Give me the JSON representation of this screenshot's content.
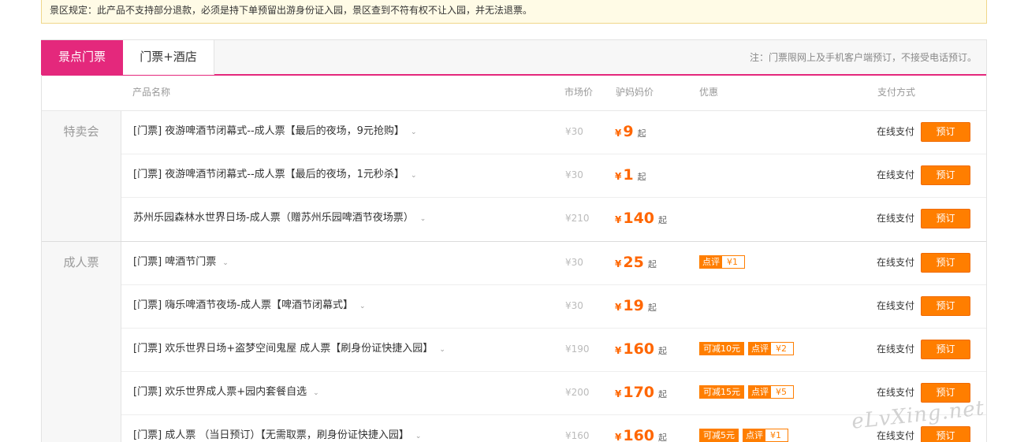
{
  "notice": "景区规定：此产品不支持部分退款，必须是持下单预留出游身份证入园，景区查到不符有权不让入园，并无法退票。",
  "tabs": {
    "active": "景点门票",
    "other": "门票+酒店",
    "note": "注：门票限网上及手机客户端预订，不接受电话预订。"
  },
  "columns": {
    "name": "产品名称",
    "market": "市场价",
    "price": "驴妈妈价",
    "promo": "优惠",
    "pay": "支付方式"
  },
  "groups": [
    {
      "label": "特卖会",
      "rows": [
        {
          "name": "[门票] 夜游啤酒节闭幕式--成人票【最后的夜场，9元抢购】",
          "market": "¥30",
          "currency": "¥",
          "price": "9",
          "qi": "起",
          "pay": "在线支付",
          "book": "预订"
        },
        {
          "name": "[门票] 夜游啤酒节闭幕式--成人票【最后的夜场，1元秒杀】",
          "market": "¥30",
          "currency": "¥",
          "price": "1",
          "qi": "起",
          "pay": "在线支付",
          "book": "预订"
        },
        {
          "name": "苏州乐园森林水世界日场-成人票（赠苏州乐园啤酒节夜场票）",
          "market": "¥210",
          "currency": "¥",
          "price": "140",
          "qi": "起",
          "pay": "在线支付",
          "book": "预订"
        }
      ]
    },
    {
      "label": "成人票",
      "rows": [
        {
          "name": "[门票] 啤酒节门票",
          "market": "¥30",
          "currency": "¥",
          "price": "25",
          "qi": "起",
          "review_label": "点评",
          "review_value": "¥1",
          "pay": "在线支付",
          "book": "预订"
        },
        {
          "name": "[门票] 嗨乐啤酒节夜场-成人票【啤酒节闭幕式】",
          "market": "¥30",
          "currency": "¥",
          "price": "19",
          "qi": "起",
          "pay": "在线支付",
          "book": "预订"
        },
        {
          "name": "[门票] 欢乐世界日场+盗梦空间鬼屋 成人票【刷身份证快捷入园】",
          "market": "¥190",
          "currency": "¥",
          "price": "160",
          "qi": "起",
          "reduce": "可减10元",
          "review_label": "点评",
          "review_value": "¥2",
          "pay": "在线支付",
          "book": "预订"
        },
        {
          "name": "[门票] 欢乐世界成人票+园内套餐自选",
          "market": "¥200",
          "currency": "¥",
          "price": "170",
          "qi": "起",
          "reduce": "可减15元",
          "review_label": "点评",
          "review_value": "¥5",
          "pay": "在线支付",
          "book": "预订"
        },
        {
          "name": "[门票] 成人票 （当日预订）【无需取票，刷身份证快捷入园】",
          "market": "¥160",
          "currency": "¥",
          "price": "160",
          "qi": "起",
          "reduce": "可减5元",
          "review_label": "点评",
          "review_value": "¥1",
          "pay": "在线支付",
          "book": "预订"
        }
      ]
    }
  ],
  "watermark": "eLvXing.net",
  "colors": {
    "accent": "#e4287c",
    "price": "#ff6600",
    "button": "#ff7e00"
  }
}
